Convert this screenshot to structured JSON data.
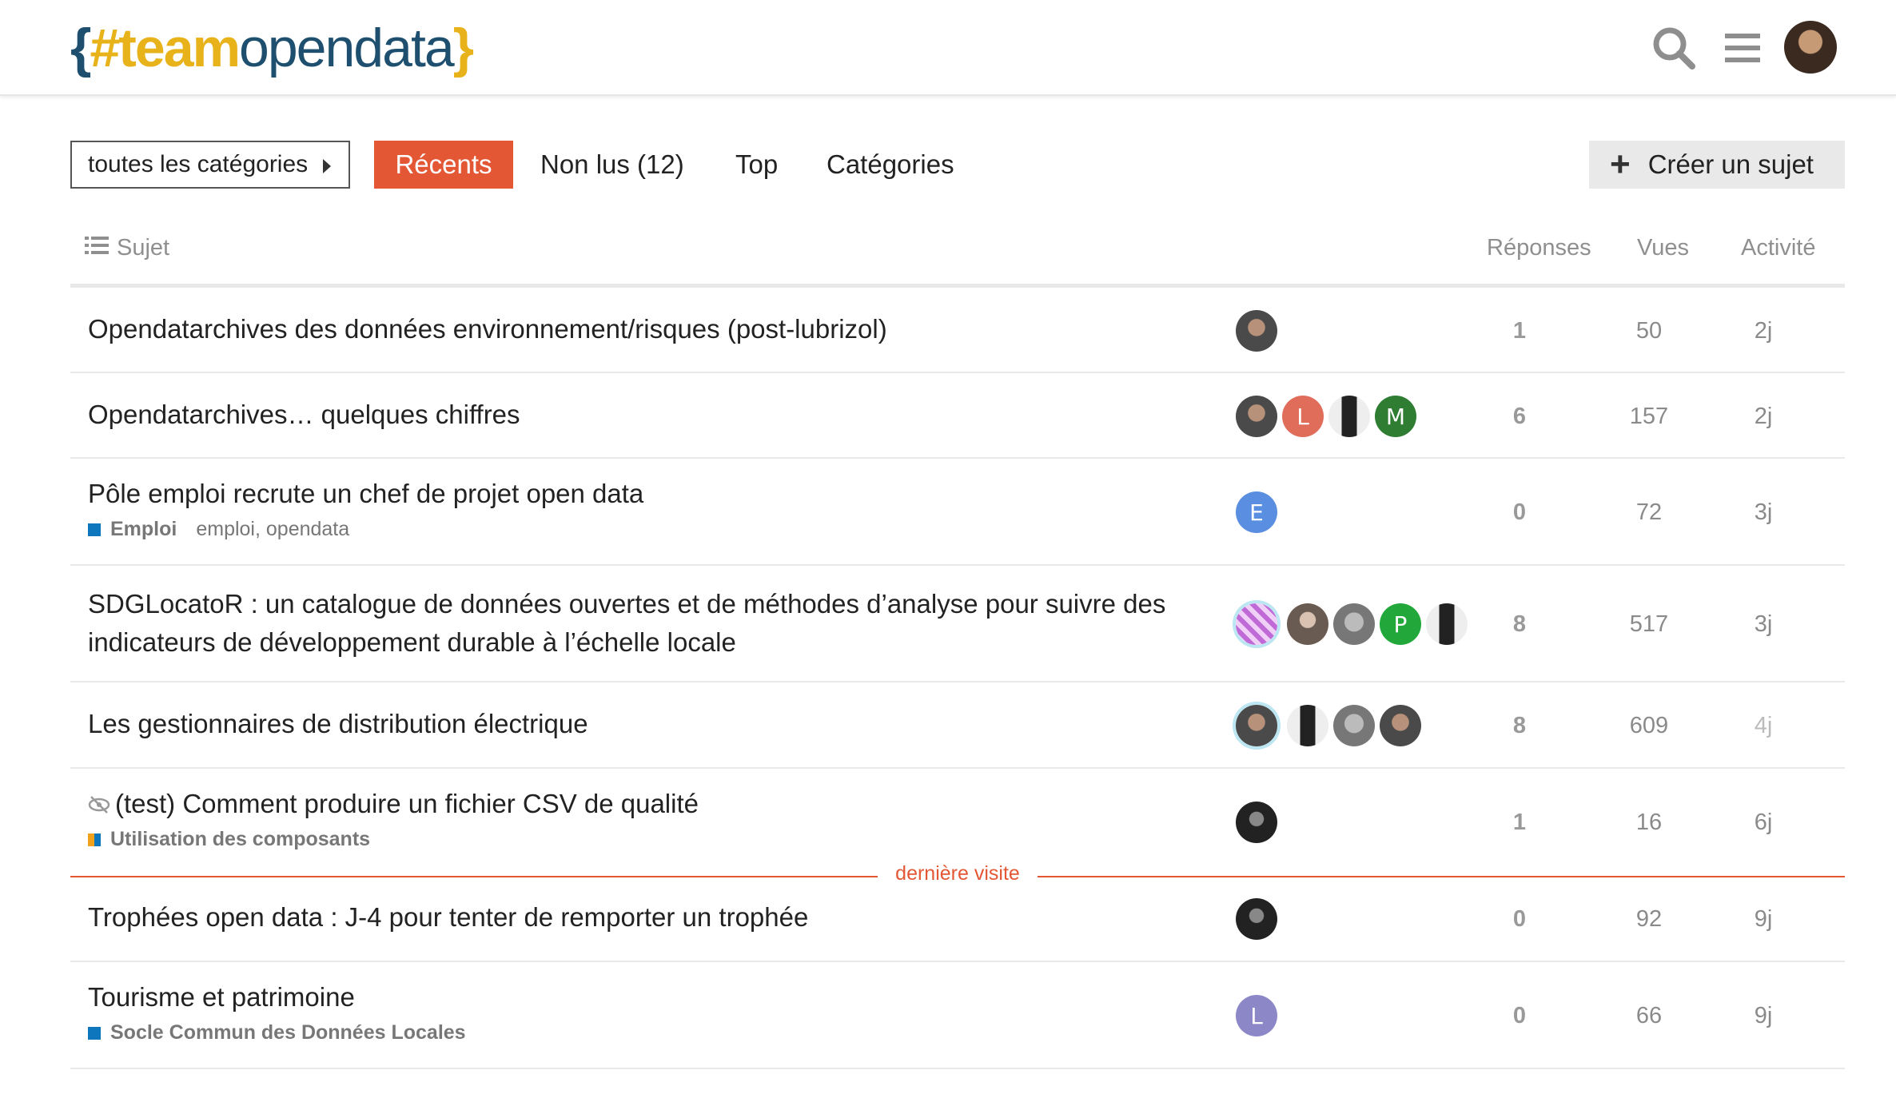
{
  "header": {
    "logo": {
      "brace_open": "{",
      "hash_team": "#team",
      "opendata": "opendata",
      "brace_close": "}"
    },
    "icons": [
      "search-icon",
      "hamburger-menu-icon",
      "user-avatar"
    ]
  },
  "nav": {
    "category_dropdown": "toutes les catégories",
    "tabs": [
      "Récents",
      "Non lus (12)",
      "Top",
      "Catégories"
    ],
    "create_button": "Créer un sujet"
  },
  "table": {
    "headers": {
      "subject": "Sujet",
      "replies": "Réponses",
      "views": "Vues",
      "activity": "Activité"
    },
    "rows": [
      {
        "title": "Opendatarchives des données environnement/risques (post-lubrizol)",
        "replies": "1",
        "views": "50",
        "activity": "2j"
      },
      {
        "title": "Opendatarchives… quelques chiffres",
        "replies": "6",
        "views": "157",
        "activity": "2j",
        "avatar_letters": [
          "L",
          "M"
        ]
      },
      {
        "title": "Pôle emploi recrute un chef de projet open data",
        "category": "Emploi",
        "tags": "emploi, opendata",
        "replies": "0",
        "views": "72",
        "activity": "3j",
        "avatar_letters": [
          "E"
        ]
      },
      {
        "title_line1": "SDGLocatoR : un catalogue de données ouvertes et de méthodes d’analyse pour suivre des",
        "title_line2": "indicateurs de développement durable à l’échelle locale",
        "replies": "8",
        "views": "517",
        "activity": "3j",
        "avatar_letters": [
          "P"
        ]
      },
      {
        "title": "Les gestionnaires de distribution électrique",
        "replies": "8",
        "views": "609",
        "activity": "4j"
      },
      {
        "title": "(test) Comment produire un fichier CSV de qualité",
        "category": "Utilisation des composants",
        "replies": "1",
        "views": "16",
        "activity": "6j"
      },
      {
        "title": "Trophées open data : J-4 pour tenter de remporter un trophée",
        "replies": "0",
        "views": "92",
        "activity": "9j"
      },
      {
        "title": "Tourisme et patrimoine",
        "category": "Socle Commun des Données Locales",
        "replies": "0",
        "views": "66",
        "activity": "9j",
        "avatar_letters": [
          "L"
        ]
      }
    ],
    "last_visit_label": "dernière visite"
  },
  "colors": {
    "accent": "#e45735",
    "logo_blue": "#1e4f6e",
    "logo_yellow": "#e8b21a",
    "cat_emploi": "#0e76bd",
    "cat_socle": "#0e76bd"
  }
}
